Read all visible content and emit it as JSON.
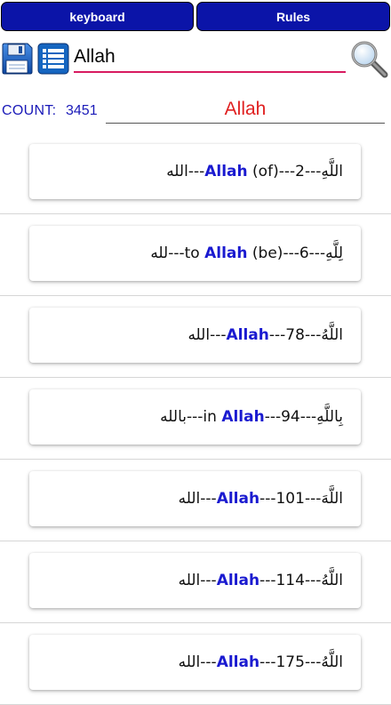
{
  "tabs": {
    "keyboard": "keyboard",
    "rules": "Rules"
  },
  "search": {
    "value": "Allah"
  },
  "count": {
    "label": "COUNT:",
    "value": "3451"
  },
  "query_display": "Allah",
  "colors": {
    "tab_bg": "#0b14a8",
    "keyword": "#1a1ad0",
    "query": "#e02020",
    "count": "#1a1ab8",
    "input_underline": "#d81b60"
  },
  "icons": {
    "save": "floppy-disk-icon",
    "list": "list-icon",
    "search": "magnifier-icon"
  },
  "results": [
    {
      "arabic": "الله",
      "trans_pre": "",
      "keyword": "Allah",
      "trans_post": " (of)",
      "vocalized": "اللَّهِ",
      "number": "2"
    },
    {
      "arabic": "لله",
      "trans_pre": "to ",
      "keyword": "Allah",
      "trans_post": " (be)",
      "vocalized": "لِلَّهِ",
      "number": "6"
    },
    {
      "arabic": "الله",
      "trans_pre": "",
      "keyword": "Allah",
      "trans_post": "",
      "vocalized": "اللَّهُ",
      "number": "78"
    },
    {
      "arabic": "بالله",
      "trans_pre": "in ",
      "keyword": "Allah",
      "trans_post": "",
      "vocalized": "بِاللَّهِ",
      "number": "94"
    },
    {
      "arabic": "الله",
      "trans_pre": "",
      "keyword": "Allah",
      "trans_post": "",
      "vocalized": "اللَّهَ",
      "number": "101"
    },
    {
      "arabic": "الله",
      "trans_pre": "",
      "keyword": "Allah",
      "trans_post": "",
      "vocalized": "اللَّهُ",
      "number": "114"
    },
    {
      "arabic": "الله",
      "trans_pre": "",
      "keyword": "Allah",
      "trans_post": "",
      "vocalized": "اللَّهُ",
      "number": "175"
    }
  ]
}
